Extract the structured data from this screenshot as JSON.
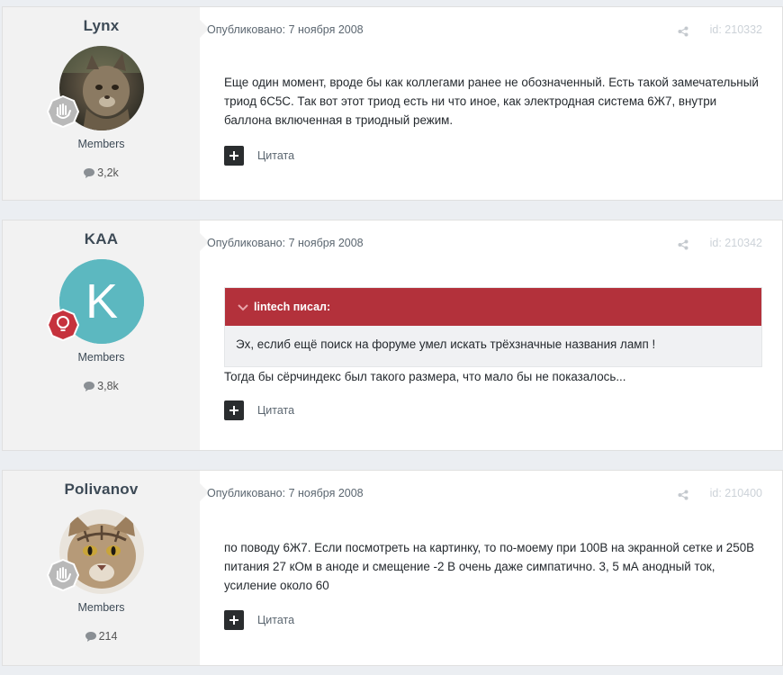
{
  "posts": [
    {
      "author": "Lynx",
      "group": "Members",
      "post_count": "3,2k",
      "published": "Опубликовано: 7 ноября 2008",
      "post_id": "id: 210332",
      "body": "Еще один момент, вроде бы как коллегами ранее не обозначенный. Есть такой замечательный триод 6С5С. Так вот этот триод есть ни что иное, как электродная система 6Ж7, внутри баллона включенная в триодный режим.",
      "quote_label": "Цитата",
      "badge_icon": "hand-badge-icon",
      "badge_color": "#b9b9b9"
    },
    {
      "author": "KAA",
      "group": "Members",
      "post_count": "3,8k",
      "published": "Опубликовано: 7 ноября 2008",
      "post_id": "id: 210342",
      "avatar_letter": "K",
      "avatar_color": "#5cb8c0",
      "quote_author": "lintech писал:",
      "quote_text": "Эх, еслиб ещё поиск на форуме умел искать трёхзначные названия ламп !",
      "body": "Тогда бы сёрчиндекс был такого размера, что мало бы не показалось...",
      "quote_label": "Цитата",
      "badge_icon": "lightbulb-badge-icon",
      "badge_color": "#c6323d"
    },
    {
      "author": "Polivanov",
      "group": "Members",
      "post_count": "214",
      "published": "Опубликовано: 7 ноября 2008",
      "post_id": "id: 210400",
      "body": "по поводу 6Ж7. Если посмотреть на картинку, то по-моему при 100В на экранной сетке и 250В питания 27 кОм в аноде и смещение -2 В очень даже симпатично. 3, 5 мА анодный ток, усиление около 60",
      "quote_label": "Цитата",
      "badge_icon": "hand-badge-icon",
      "badge_color": "#b9b9b9"
    }
  ],
  "colors": {
    "quote_header": "#b3313b",
    "sidebar": "#f2f2f2",
    "page_bg": "#ebeef2"
  }
}
